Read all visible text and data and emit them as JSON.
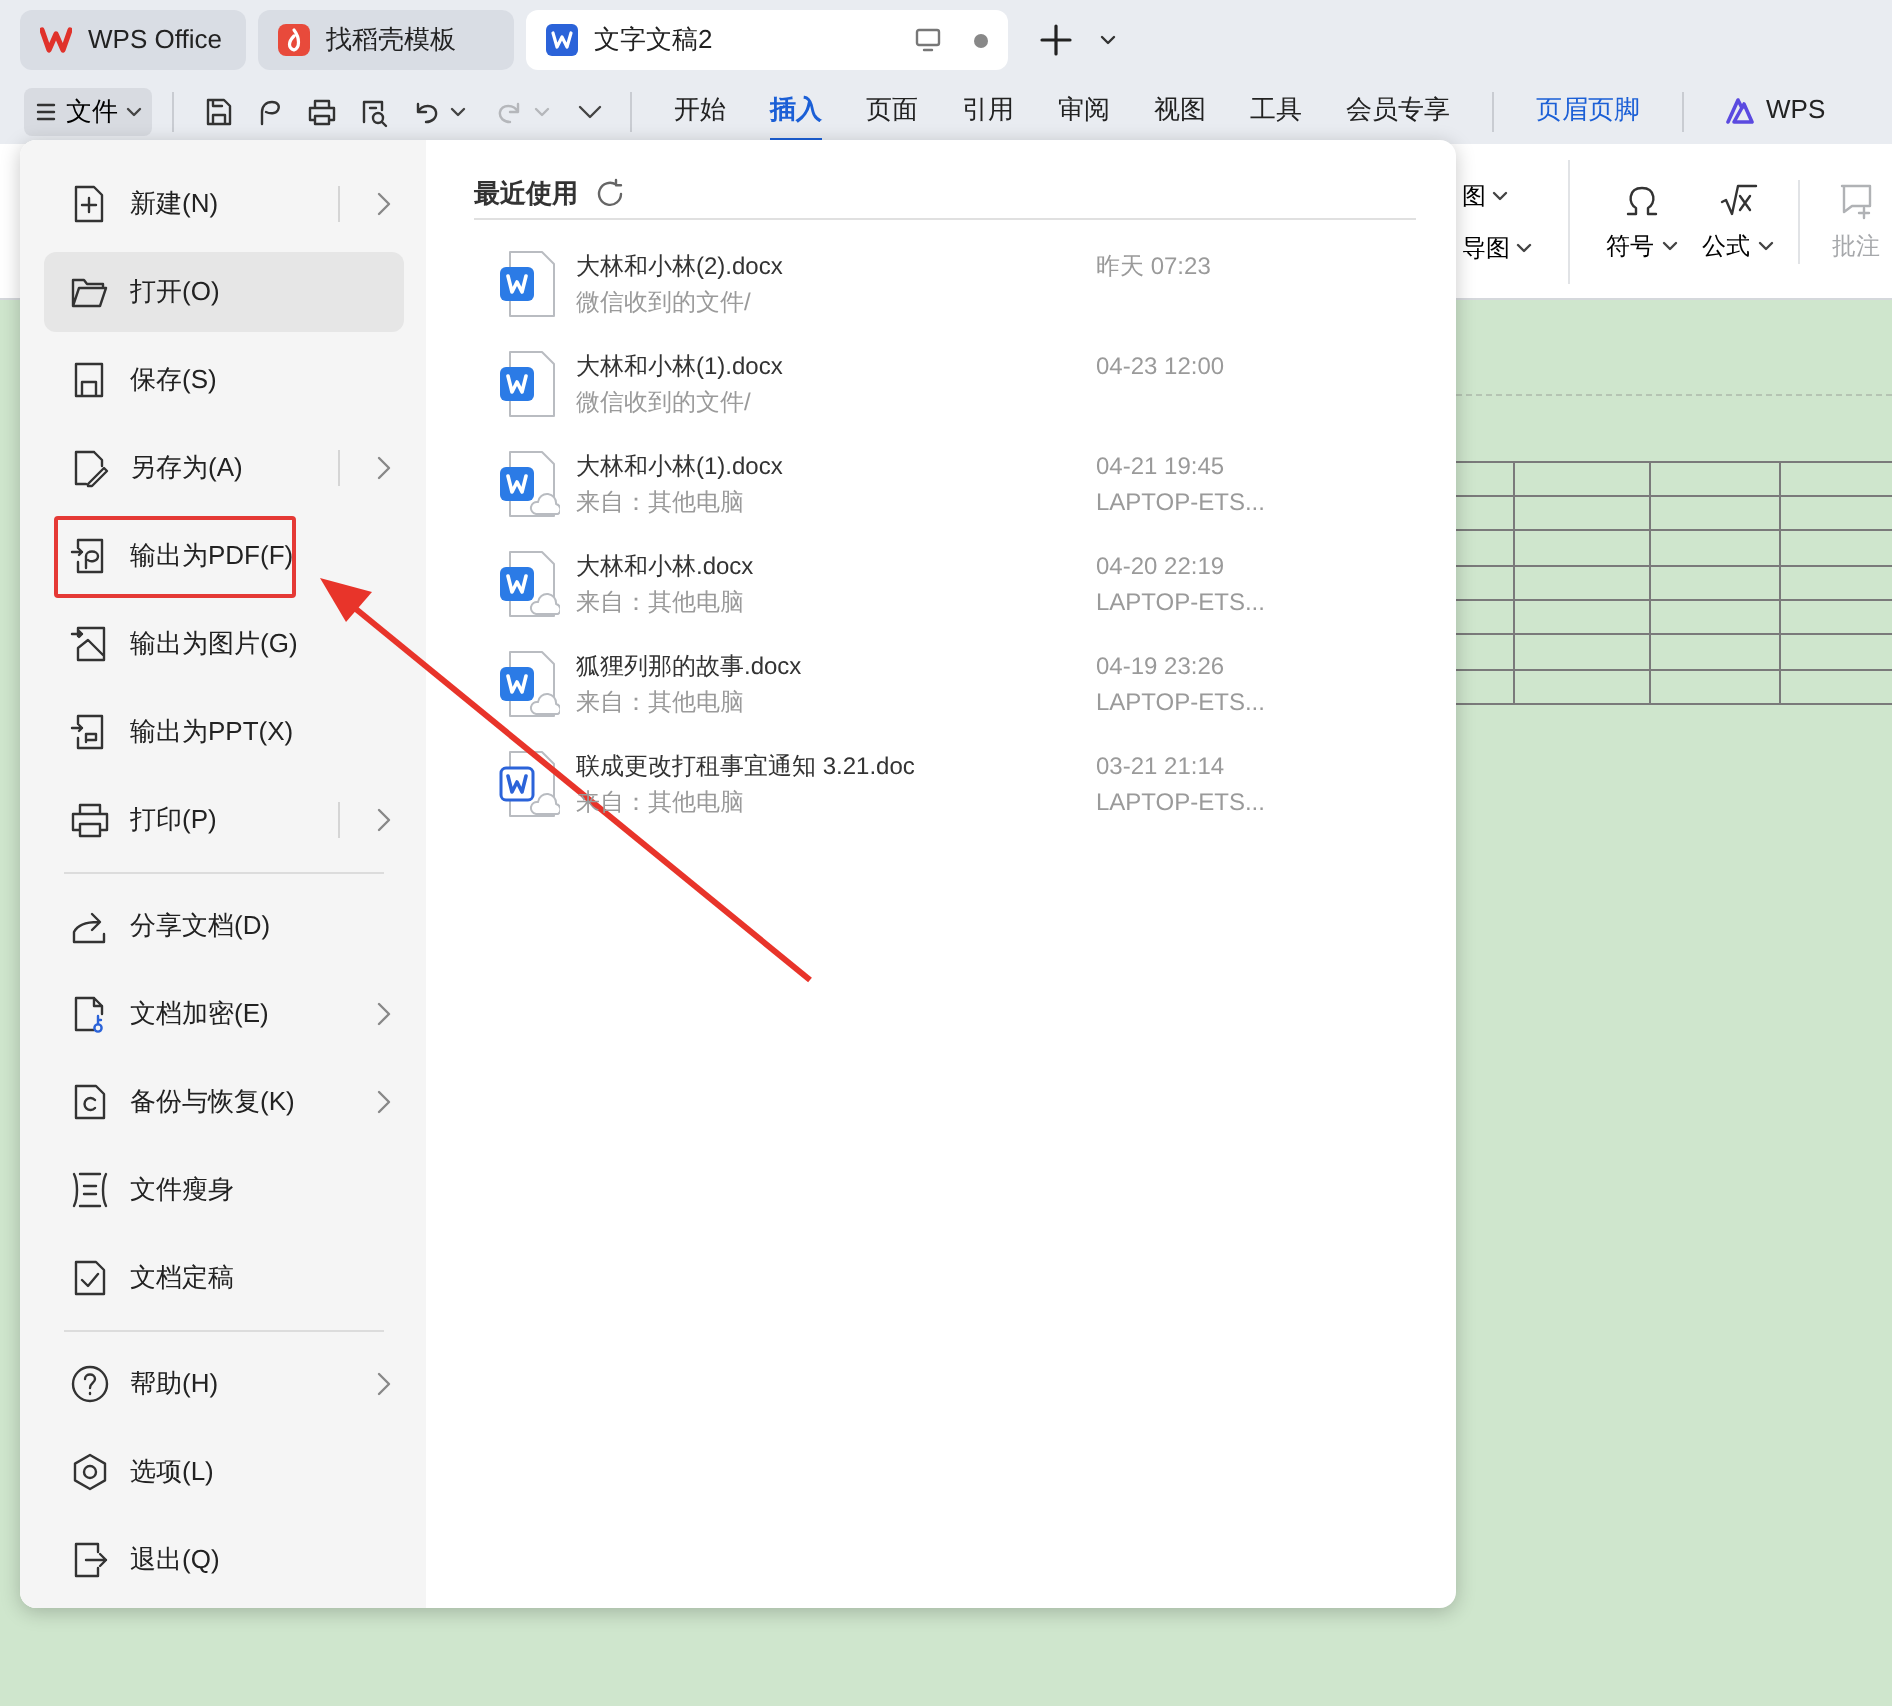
{
  "doc_tabs": [
    {
      "label": "WPS Office",
      "selected": false
    },
    {
      "label": "找稻壳模板",
      "selected": false
    },
    {
      "label": "文字文稿2",
      "selected": true
    }
  ],
  "file_button": {
    "label": "文件",
    "expanded": true
  },
  "quick_access": [
    {
      "disabled": false,
      "dropdown": false
    },
    {
      "disabled": false,
      "dropdown": false
    },
    {
      "disabled": false,
      "dropdown": false
    },
    {
      "disabled": false,
      "dropdown": false
    },
    {
      "disabled": false,
      "dropdown": true
    },
    {
      "disabled": true,
      "dropdown": true
    }
  ],
  "ribbon_tabs": [
    {
      "label": "开始",
      "selected": false,
      "kind": "tab"
    },
    {
      "label": "插入",
      "selected": true,
      "kind": "tab"
    },
    {
      "label": "页面",
      "selected": false,
      "kind": "tab"
    },
    {
      "label": "引用",
      "selected": false,
      "kind": "tab"
    },
    {
      "label": "审阅",
      "selected": false,
      "kind": "tab"
    },
    {
      "label": "视图",
      "selected": false,
      "kind": "tab"
    },
    {
      "label": "工具",
      "selected": false,
      "kind": "tab"
    },
    {
      "label": "会员专享",
      "selected": false,
      "kind": "tab"
    },
    {
      "label": "页眉页脚",
      "selected": false,
      "kind": "contextual"
    },
    {
      "label": "WPS",
      "selected": false,
      "kind": "ai"
    }
  ],
  "ribbon_commands": [
    {
      "label": "图",
      "kind": "small",
      "dropdown": true,
      "disabled": false
    },
    {
      "label": "导图",
      "kind": "small",
      "dropdown": true,
      "disabled": false
    },
    {
      "label": "符号",
      "kind": "large",
      "dropdown": true,
      "disabled": false
    },
    {
      "label": "公式",
      "kind": "large",
      "dropdown": true,
      "disabled": false
    },
    {
      "label": "批注",
      "kind": "large",
      "dropdown": false,
      "disabled": true
    }
  ],
  "file_menu": {
    "items": [
      {
        "kind": "item",
        "label": "新建(N)",
        "hovered": false,
        "submenu": true,
        "split": true,
        "annotated": false
      },
      {
        "kind": "item",
        "label": "打开(O)",
        "hovered": true,
        "submenu": false,
        "annotated": false
      },
      {
        "kind": "item",
        "label": "保存(S)",
        "hovered": false,
        "submenu": false,
        "annotated": false
      },
      {
        "kind": "item",
        "label": "另存为(A)",
        "hovered": false,
        "submenu": true,
        "split": true,
        "annotated": false
      },
      {
        "kind": "item",
        "label": "输出为PDF(F)",
        "hovered": false,
        "submenu": false,
        "annotated": true
      },
      {
        "kind": "item",
        "label": "输出为图片(G)",
        "hovered": false,
        "submenu": false,
        "annotated": false
      },
      {
        "kind": "item",
        "label": "输出为PPT(X)",
        "hovered": false,
        "submenu": false,
        "annotated": false
      },
      {
        "kind": "item",
        "label": "打印(P)",
        "hovered": false,
        "submenu": true,
        "split": true,
        "annotated": false
      },
      {
        "kind": "divider"
      },
      {
        "kind": "item",
        "label": "分享文档(D)",
        "hovered": false,
        "submenu": false,
        "annotated": false
      },
      {
        "kind": "item",
        "label": "文档加密(E)",
        "hovered": false,
        "submenu": true,
        "split": false,
        "annotated": false
      },
      {
        "kind": "item",
        "label": "备份与恢复(K)",
        "hovered": false,
        "submenu": true,
        "split": false,
        "annotated": false
      },
      {
        "kind": "item",
        "label": "文件瘦身",
        "hovered": false,
        "submenu": false,
        "annotated": false
      },
      {
        "kind": "item",
        "label": "文档定稿",
        "hovered": false,
        "submenu": false,
        "annotated": false
      },
      {
        "kind": "divider"
      },
      {
        "kind": "item",
        "label": "帮助(H)",
        "hovered": false,
        "submenu": true,
        "split": false,
        "annotated": false
      },
      {
        "kind": "item",
        "label": "选项(L)",
        "hovered": false,
        "submenu": false,
        "annotated": false
      },
      {
        "kind": "item",
        "label": "退出(Q)",
        "hovered": false,
        "submenu": false,
        "annotated": false
      }
    ]
  },
  "recent": {
    "title": "最近使用",
    "files": [
      {
        "name": "大林和小林(2).docx",
        "location": "微信收到的文件/",
        "time": "昨天 07:23",
        "kind": "docx",
        "cloud": false
      },
      {
        "name": "大林和小林(1).docx",
        "location": "微信收到的文件/",
        "time": "04-23 12:00",
        "kind": "docx",
        "cloud": false
      },
      {
        "name": "大林和小林(1).docx",
        "location": "来自：其他电脑",
        "time": "04-21 19:45",
        "device": "LAPTOP-ETS...",
        "kind": "docx",
        "cloud": true
      },
      {
        "name": "大林和小林.docx",
        "location": "来自：其他电脑",
        "time": "04-20 22:19",
        "device": "LAPTOP-ETS...",
        "kind": "docx",
        "cloud": true
      },
      {
        "name": "狐狸列那的故事.docx",
        "location": "来自：其他电脑",
        "time": "04-19 23:26",
        "device": "LAPTOP-ETS...",
        "kind": "docx",
        "cloud": true
      },
      {
        "name": "联成更改打租事宜通知 3.21.doc",
        "location": "来自：其他电脑",
        "time": "03-21 21:14",
        "device": "LAPTOP-ETS...",
        "kind": "doc",
        "cloud": true
      }
    ]
  }
}
